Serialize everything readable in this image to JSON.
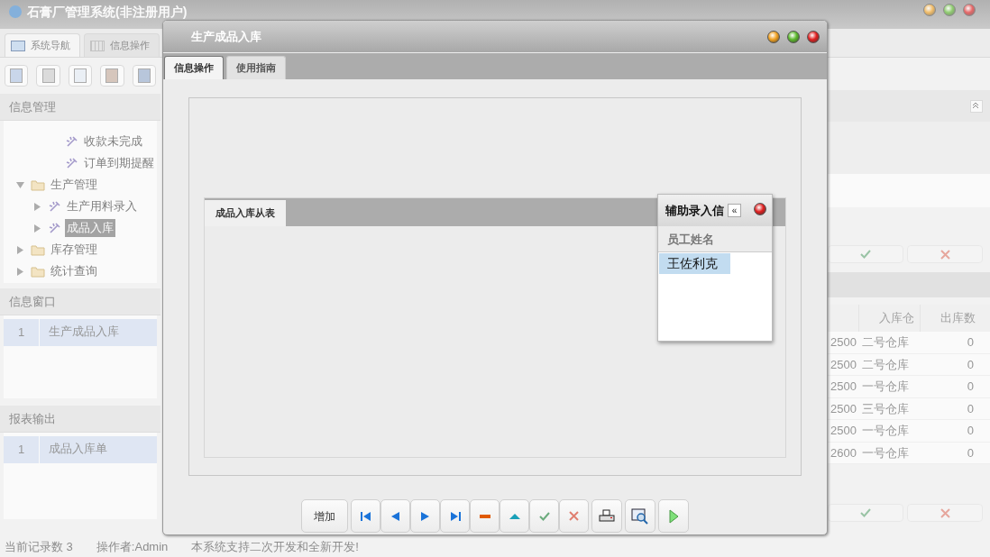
{
  "app": {
    "title": "石膏厂管理系统(非注册用户)",
    "tabs": [
      {
        "label": "系统导航",
        "selected": true
      },
      {
        "label": "信息操作",
        "selected": false
      }
    ]
  },
  "info_management": {
    "title": "信息管理",
    "tree": [
      {
        "kind": "folder",
        "children": [
          {
            "kind": "item",
            "children": [
              {
                "kind": "leaf",
                "label": "收款未完成",
                "selected": false
              },
              {
                "kind": "leaf",
                "label": "订单到期提醒",
                "selected": false
              }
            ]
          }
        ]
      },
      {
        "kind": "folder",
        "label": "生产管理",
        "expanded": true,
        "selected": false,
        "children": [
          {
            "kind": "item",
            "label": "生产用料录入",
            "expanded": false,
            "selected": false
          },
          {
            "kind": "item",
            "label": "成品入库",
            "expanded": false,
            "selected": true
          }
        ]
      },
      {
        "kind": "folder",
        "label": "库存管理",
        "expanded": false,
        "selected": false
      },
      {
        "kind": "folder",
        "label": "统计查询",
        "expanded": false,
        "selected": false
      }
    ]
  },
  "info_window": {
    "title": "信息窗口",
    "rows": [
      {
        "index": "1",
        "name": "生产成品入库"
      }
    ]
  },
  "report_output": {
    "title": "报表输出",
    "rows": [
      {
        "index": "1",
        "name": "成品入库单"
      }
    ]
  },
  "right_table": {
    "columns": [
      "入库仓",
      "出库数"
    ],
    "rows": [
      {
        "column_1": "2500",
        "warehouse": "二号仓库",
        "quantity": "0"
      },
      {
        "column_1": "2500",
        "warehouse": "二号仓库",
        "quantity": "0"
      },
      {
        "column_1": "2500",
        "warehouse": "一号仓库",
        "quantity": "0"
      },
      {
        "column_1": "2500",
        "warehouse": "三号仓库",
        "quantity": "0"
      },
      {
        "column_1": "2500",
        "warehouse": "一号仓库",
        "quantity": "0"
      },
      {
        "column_1": "2600",
        "warehouse": "一号仓库",
        "quantity": "0"
      }
    ]
  },
  "status_bar": [
    "当前记录数 3",
    "操作者:Admin",
    "本系统支持二次开发和全新开发!"
  ],
  "dialog": {
    "title": "生产成品入库",
    "tabs": [
      {
        "label": "信息操作",
        "selected": true
      },
      {
        "label": "使用指南",
        "selected": false
      }
    ],
    "subtabs": [
      {
        "label": "成品入库从表",
        "selected": true
      }
    ],
    "popup": {
      "title": "辅助录入信",
      "collapse": "«",
      "column": "员工姓名",
      "rows": [
        {
          "name": "王佐利克",
          "selected": true
        }
      ]
    },
    "buttons": [
      {
        "kind": "text",
        "label": "增加"
      },
      {
        "kind": "first"
      },
      {
        "kind": "prev"
      },
      {
        "kind": "next"
      },
      {
        "kind": "last"
      },
      {
        "kind": "delete"
      },
      {
        "kind": "up"
      },
      {
        "kind": "confirm"
      },
      {
        "kind": "cancel"
      },
      {
        "kind": "print"
      },
      {
        "kind": "preview"
      },
      {
        "kind": "run"
      }
    ]
  }
}
